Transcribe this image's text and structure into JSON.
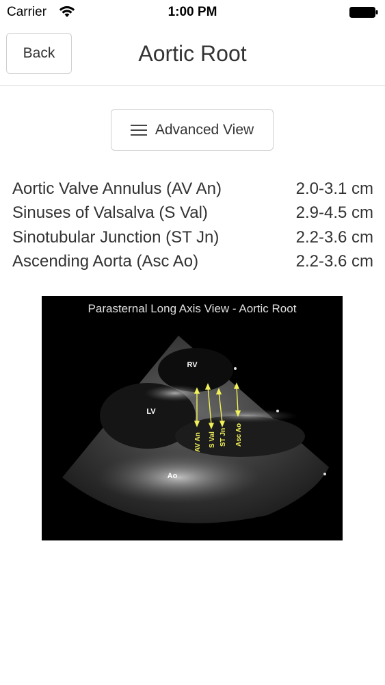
{
  "status_bar": {
    "carrier": "Carrier",
    "time": "1:00 PM"
  },
  "nav": {
    "back_label": "Back",
    "title": "Aortic Root"
  },
  "advanced_button": {
    "label": "Advanced View",
    "icon": "menu-icon"
  },
  "measurements": [
    {
      "label": "Aortic Valve Annulus (AV An)",
      "value": "2.0-3.1 cm"
    },
    {
      "label": "Sinuses of Valsalva (S Val)",
      "value": "2.9-4.5 cm"
    },
    {
      "label": "Sinotubular Junction (ST Jn)",
      "value": "2.2-3.6 cm"
    },
    {
      "label": "Ascending Aorta (Asc Ao)",
      "value": "2.2-3.6 cm"
    }
  ],
  "echo_image": {
    "caption": "Parasternal Long Axis View - Aortic Root",
    "labels": {
      "rv": "RV",
      "lv": "LV",
      "ao": "Ao",
      "av_an": "AV An",
      "s_val": "S Val",
      "st_jn": "ST Jn",
      "asc_ao": "Asc Ao"
    },
    "annotation_color": "#f2f25a"
  }
}
